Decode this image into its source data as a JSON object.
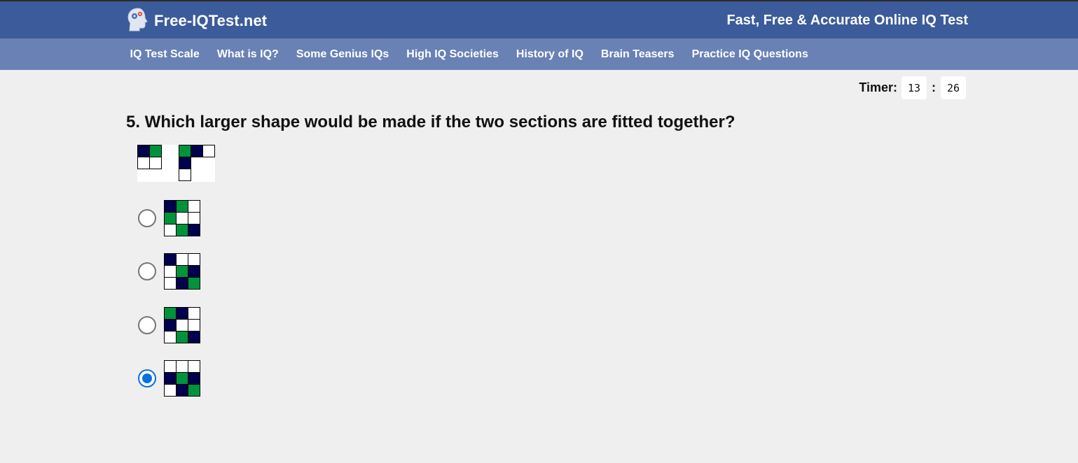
{
  "header": {
    "logo_text": "Free-IQTest.net",
    "tagline": "Fast, Free & Accurate Online IQ Test",
    "background": "#3c5b9a"
  },
  "nav": {
    "items": [
      "IQ Test Scale",
      "What is IQ?",
      "Some Genius IQs",
      "High IQ Societies",
      "History of IQ",
      "Brain Teasers",
      "Practice IQ Questions"
    ],
    "background": "#6a81b5"
  },
  "timer": {
    "label": "Timer:",
    "minutes": "13",
    "separator": ":",
    "seconds": "26"
  },
  "question": {
    "text": "5. Which larger shape would be made if the two sections are fitted together?",
    "sections": [
      [
        [
          "navy",
          "green"
        ],
        [
          "white",
          "white"
        ]
      ],
      [
        [
          "green",
          "navy",
          "white"
        ],
        [
          "navy",
          null,
          null
        ],
        [
          "white",
          null,
          null
        ]
      ]
    ],
    "options": [
      {
        "grid": [
          [
            "navy",
            "green",
            "white"
          ],
          [
            "green",
            "white",
            "white"
          ],
          [
            "white",
            "green",
            "navy"
          ]
        ],
        "selected": false
      },
      {
        "grid": [
          [
            "navy",
            "white",
            "white"
          ],
          [
            "white",
            "green",
            "navy"
          ],
          [
            "white",
            "navy",
            "green"
          ]
        ],
        "selected": false
      },
      {
        "grid": [
          [
            "green",
            "navy",
            "white"
          ],
          [
            "navy",
            "white",
            "white"
          ],
          [
            "white",
            "green",
            "navy"
          ]
        ],
        "selected": false
      },
      {
        "grid": [
          [
            "white",
            "white",
            "white"
          ],
          [
            "navy",
            "green",
            "navy"
          ],
          [
            "white",
            "navy",
            "green"
          ]
        ],
        "selected": true
      }
    ]
  },
  "colors": {
    "navy": "#00004d",
    "green": "#00933c",
    "white": "#ffffff",
    "radio_selected": "#0a6fe0"
  }
}
